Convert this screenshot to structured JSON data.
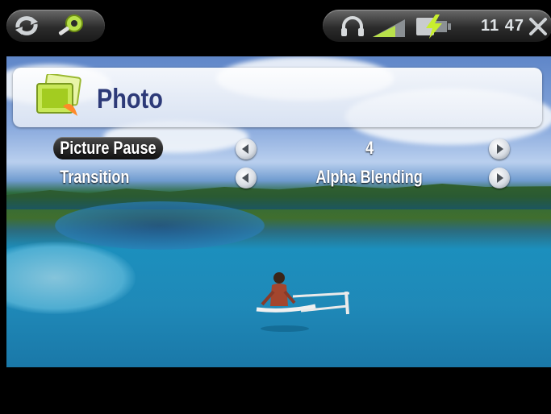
{
  "status": {
    "time": "11 47",
    "icons": [
      "sync-icon",
      "settings-gear-icon",
      "headphones-icon",
      "signal-strength-icon",
      "battery-charging-icon",
      "close-icon"
    ]
  },
  "header": {
    "title": "Photo",
    "icon": "photo-stack-icon"
  },
  "settings": [
    {
      "label": "Picture Pause",
      "value": "4",
      "selected": true
    },
    {
      "label": "Transition",
      "value": "Alpha Blending",
      "selected": false
    }
  ],
  "colors": {
    "header_text": "#2d3a78",
    "header_panel": "#eef2f8",
    "status_bar": "#000000"
  }
}
